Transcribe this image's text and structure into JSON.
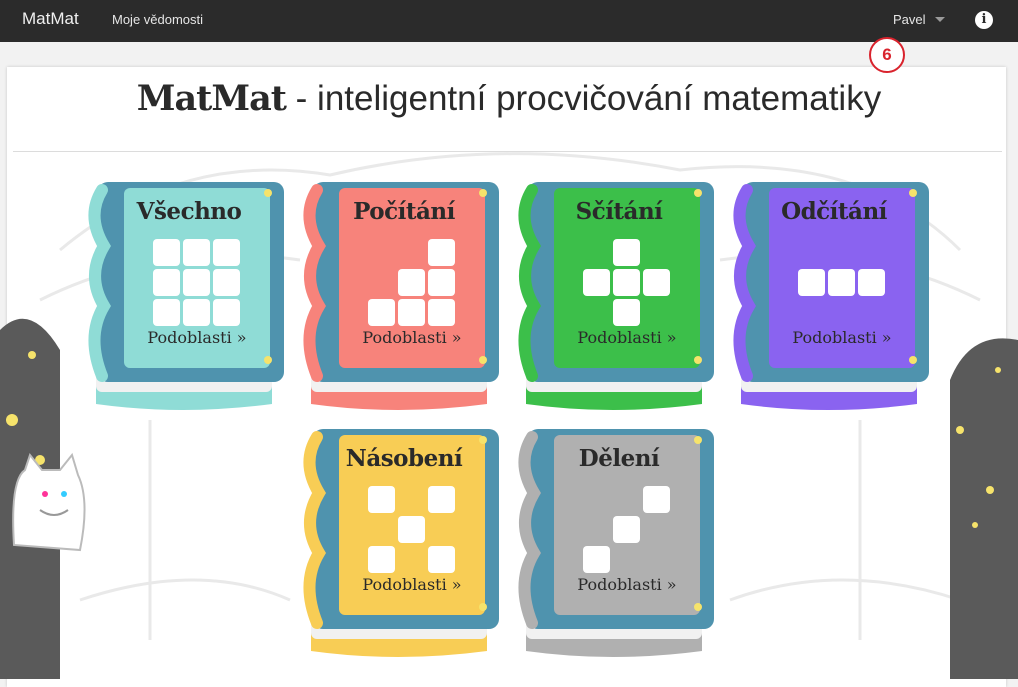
{
  "navbar": {
    "brand": "MatMat",
    "link": "Moje vědomosti",
    "user": "Pavel",
    "info_icon": "info-icon",
    "badge_count": "6"
  },
  "page": {
    "title_brand": "MatMat",
    "title_rest": " - inteligentní procvičování matematiky"
  },
  "books": [
    {
      "title": "Všechno",
      "link": "Podoblasti »",
      "color": "#8fdcd6"
    },
    {
      "title": "Počítání",
      "link": "Podoblasti »",
      "color": "#f7837b"
    },
    {
      "title": "Sčítání",
      "link": "Podoblasti »",
      "color": "#3cbf4a"
    },
    {
      "title": "Odčítání",
      "link": "Podoblasti »",
      "color": "#8a63f0"
    },
    {
      "title": "Násobení",
      "link": "Podoblasti »",
      "color": "#f8cd55"
    },
    {
      "title": "Dělení",
      "link": "Podoblasti »",
      "color": "#b0b0b0"
    }
  ],
  "colors": {
    "navbar": "#2b2b2b",
    "book_frame": "#4f93ae",
    "badge": "#d9232d"
  }
}
